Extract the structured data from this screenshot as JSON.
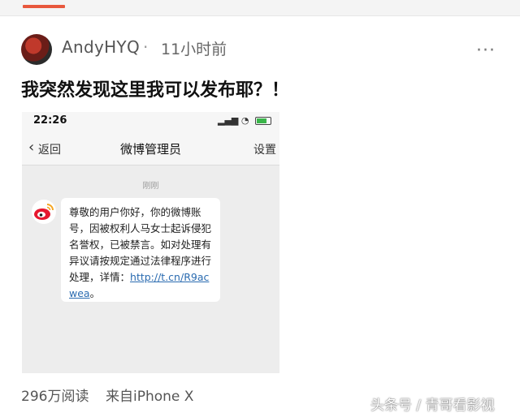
{
  "post": {
    "username": "AndyHYQ",
    "separator": "·",
    "time": "11小时前",
    "more": "···",
    "text": "我突然发现这里我可以发布耶？！",
    "reads": "296万阅读",
    "source": "来自iPhone X"
  },
  "screenshot": {
    "status_time": "22:26",
    "status_icons": "..ıl ",
    "nav": {
      "back_icon": "chevron-left-icon",
      "back_label": "返回",
      "title": "微博管理员",
      "settings": "设置"
    },
    "message_time": "刚刚",
    "message_text": "尊敬的用户你好，你的微博账号，因被权利人马女士起诉侵犯名誉权，已被禁言。如对处理有异议请按规定通过法律程序进行处理，详情：",
    "message_link": "http://t.cn/R9acwea",
    "message_end": "。"
  },
  "watermark": "头条号 / 青哥看影视",
  "colors": {
    "accent": "#e8583d",
    "link": "#2a6bb0",
    "weibo_red": "#e6162d",
    "weibo_gold": "#f5a623"
  }
}
